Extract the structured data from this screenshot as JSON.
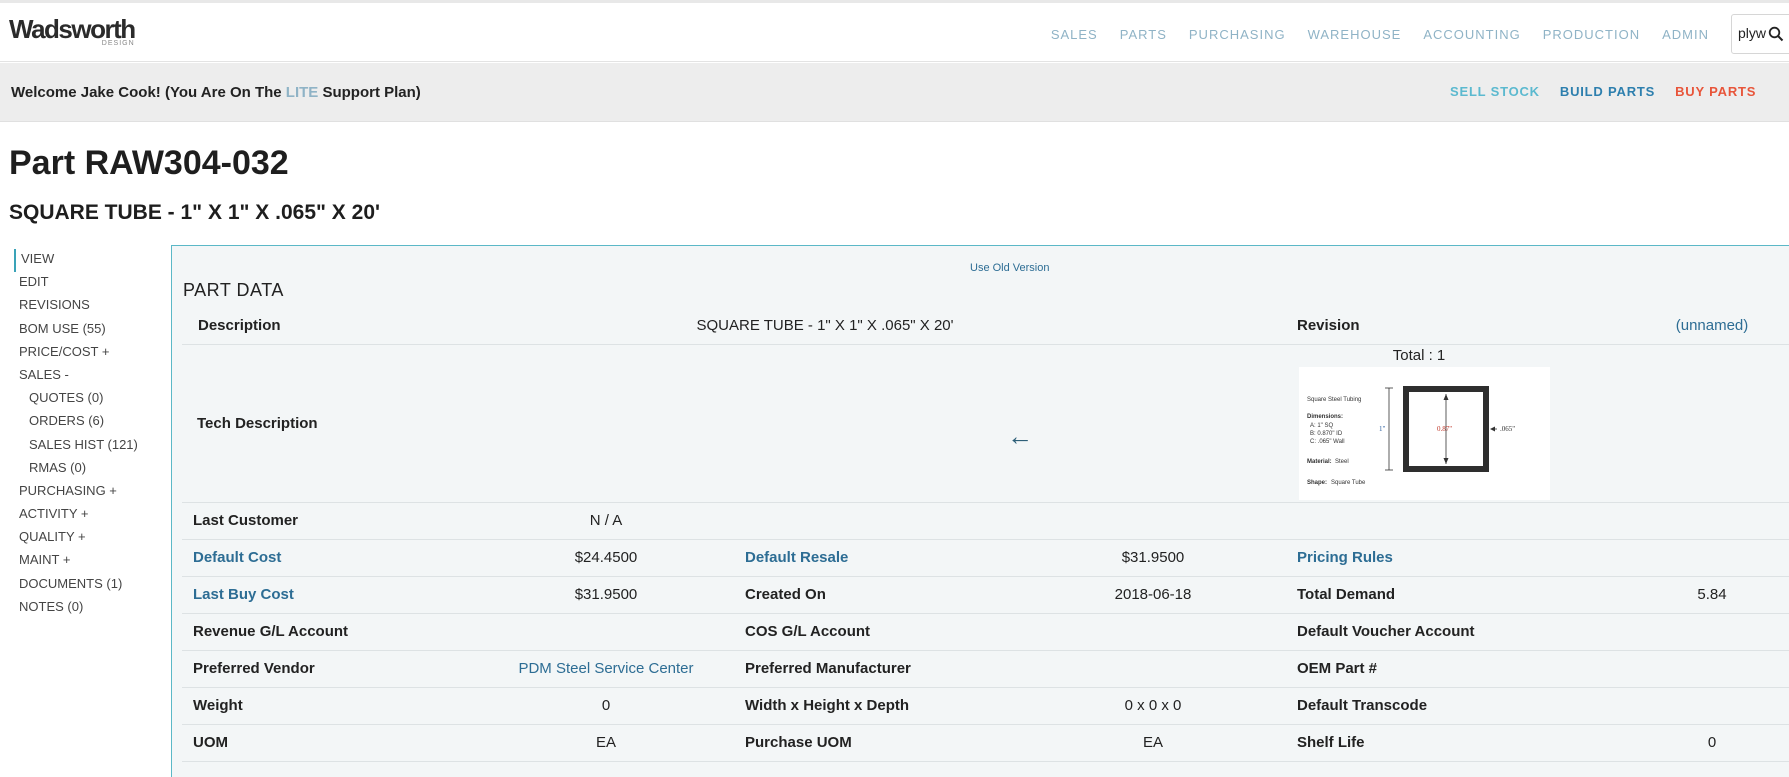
{
  "logo": {
    "text": "Wadsworth",
    "sub": "DESIGN"
  },
  "nav": [
    "SALES",
    "PARTS",
    "PURCHASING",
    "WAREHOUSE",
    "ACCOUNTING",
    "PRODUCTION",
    "ADMIN"
  ],
  "search": {
    "value": "plyw"
  },
  "welcome": {
    "prefix": "Welcome Jake Cook! (You Are On The ",
    "plan": "LITE",
    "suffix": " Support Plan)"
  },
  "quick_links": {
    "sell": "SELL STOCK",
    "build": "BUILD PARTS",
    "buy": "BUY PARTS"
  },
  "part": {
    "title": "Part RAW304-032",
    "subtitle": "SQUARE TUBE - 1\" X 1\" X .065\" X 20'"
  },
  "sidebar": [
    {
      "label": "VIEW"
    },
    {
      "label": "EDIT"
    },
    {
      "label": "REVISIONS"
    },
    {
      "label": "BOM USE (55)"
    },
    {
      "label": "PRICE/COST +"
    },
    {
      "label": "SALES -"
    },
    {
      "label": "QUOTES (0)"
    },
    {
      "label": "ORDERS (6)"
    },
    {
      "label": "SALES HIST (121)"
    },
    {
      "label": "RMAS (0)"
    },
    {
      "label": "PURCHASING +"
    },
    {
      "label": "ACTIVITY +"
    },
    {
      "label": "QUALITY +"
    },
    {
      "label": "MAINT +"
    },
    {
      "label": "DOCUMENTS (1)"
    },
    {
      "label": "NOTES (0)"
    }
  ],
  "panel": {
    "old_version": "Use Old Version",
    "heading": "PART DATA",
    "description_label": "Description",
    "description_value": "SQUARE TUBE - 1\" X 1\" X .065\" X 20'",
    "revision_label": "Revision",
    "revision_value": "(unnamed)",
    "tech_label": "Tech Description",
    "arrow": "←",
    "image_total": "Total : 1",
    "image": {
      "caption": "Square Steel Tubing",
      "dimensions_label": "Dimensions:",
      "dim_a": "A: 1\" SQ",
      "dim_b": "B: 0.870\" ID",
      "dim_c": "C: .065\" Wall",
      "material_label": "Material:",
      "material": "Steel",
      "shape_label": "Shape:",
      "shape": "Square Tube",
      "outer": "1\"",
      "inner": "0.87\"",
      "wall": ".065\""
    },
    "rows": {
      "last_customer": {
        "label": "Last Customer",
        "value": "N / A"
      },
      "default_cost": {
        "label": "Default Cost",
        "value": "$24.4500"
      },
      "default_resale": {
        "label": "Default Resale",
        "value": "$31.9500"
      },
      "pricing_rules": {
        "label": "Pricing Rules"
      },
      "last_buy_cost": {
        "label": "Last Buy Cost",
        "value": "$31.9500"
      },
      "created_on": {
        "label": "Created On",
        "value": "2018-06-18"
      },
      "total_demand": {
        "label": "Total Demand",
        "value": "5.84"
      },
      "revenue_gl": {
        "label": "Revenue G/L Account"
      },
      "cos_gl": {
        "label": "COS G/L Account"
      },
      "default_voucher": {
        "label": "Default Voucher Account"
      },
      "preferred_vendor": {
        "label": "Preferred Vendor",
        "value": "PDM Steel Service Center"
      },
      "preferred_mfr": {
        "label": "Preferred Manufacturer"
      },
      "oem_part": {
        "label": "OEM Part #"
      },
      "weight": {
        "label": "Weight",
        "value": "0"
      },
      "whd": {
        "label": "Width x Height x Depth",
        "value": "0 x 0 x 0"
      },
      "default_transcode": {
        "label": "Default Transcode"
      },
      "uom": {
        "label": "UOM",
        "value": "EA"
      },
      "purchase_uom": {
        "label": "Purchase UOM",
        "value": "EA"
      },
      "shelf_life": {
        "label": "Shelf Life",
        "value": "0"
      }
    }
  }
}
